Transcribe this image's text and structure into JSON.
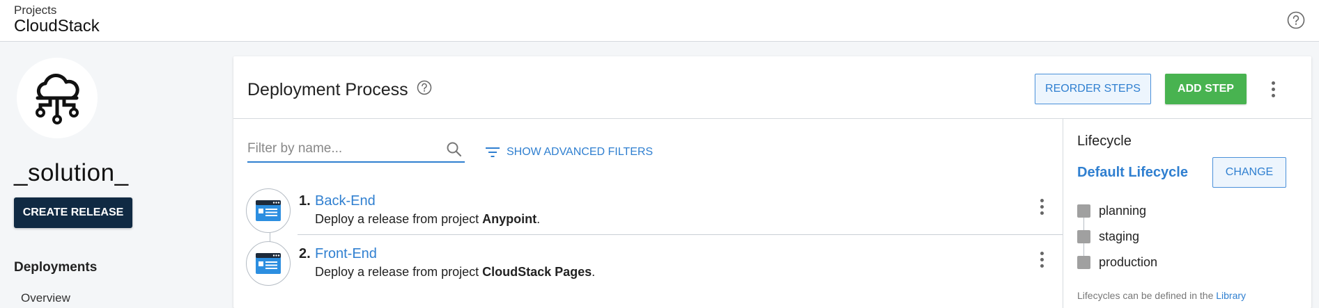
{
  "header": {
    "breadcrumb": "Projects",
    "title": "CloudStack",
    "help_icon": "question-circle-icon"
  },
  "sidebar": {
    "logo_icon": "cloud-network-icon",
    "project_name": "_solution_",
    "create_release_label": "CREATE RELEASE",
    "section_heading": "Deployments",
    "items": [
      {
        "label": "Overview"
      }
    ]
  },
  "main": {
    "title": "Deployment Process",
    "reorder_label": "REORDER STEPS",
    "add_step_label": "ADD STEP",
    "filter": {
      "placeholder": "Filter by name...",
      "advanced_label": "SHOW ADVANCED FILTERS"
    },
    "steps": [
      {
        "number": "1.",
        "name": "Back-End",
        "desc_prefix": "Deploy a release from project ",
        "desc_project": "Anypoint",
        "desc_suffix": ".",
        "icon": "deploy-release-icon"
      },
      {
        "number": "2.",
        "name": "Front-End",
        "desc_prefix": "Deploy a release from project ",
        "desc_project": "CloudStack Pages",
        "desc_suffix": ".",
        "icon": "deploy-release-icon"
      }
    ]
  },
  "lifecycle": {
    "title": "Lifecycle",
    "name": "Default Lifecycle",
    "change_label": "CHANGE",
    "phases": [
      {
        "label": "planning"
      },
      {
        "label": "staging"
      },
      {
        "label": "production"
      }
    ],
    "note_prefix": "Lifecycles can be defined in the ",
    "note_link": "Library"
  },
  "colors": {
    "accent": "#2f7fd0",
    "add_button": "#48b350",
    "create_release": "#102a43",
    "phase_box": "#a0a0a0"
  }
}
